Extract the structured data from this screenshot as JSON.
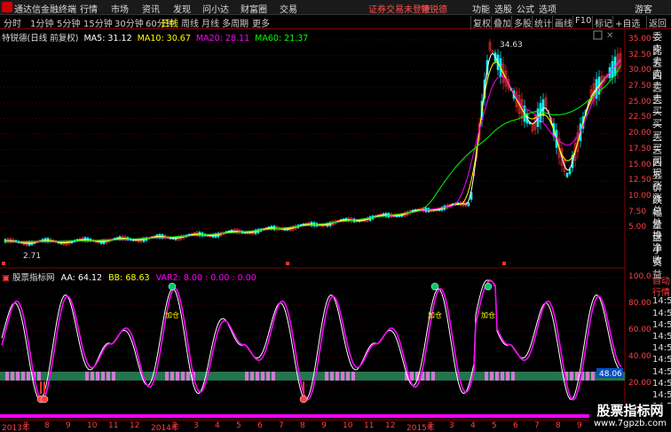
{
  "app": {
    "title": "通达信金融终端",
    "login": "证券交易未登录",
    "stock": "特锐德",
    "guest": "游客"
  },
  "menu": [
    "行情",
    "市场",
    "资讯",
    "发现",
    "问小达",
    "财富圈",
    "交易"
  ],
  "right_menu": [
    "功能",
    "选股",
    "公式",
    "选项"
  ],
  "periods": [
    "分时",
    "1分钟",
    "5分钟",
    "15分钟",
    "30分钟",
    "60分钟",
    "日线",
    "周线",
    "月线",
    "多周期",
    "更多"
  ],
  "active_period": "日线",
  "tools": [
    "复权",
    "叠加",
    "多股",
    "统计",
    "画线",
    "F10",
    "标记",
    "+自选",
    "返回"
  ],
  "main_info": {
    "name": "特锐德(日线 前复权)",
    "ma5": "MA5: 31.12",
    "ma10": "MA10: 30.67",
    "ma20": "MA20: 28.11",
    "ma60": "MA60: 21.37"
  },
  "price_axis": [
    "35.00",
    "32.50",
    "30.00",
    "27.50",
    "25.00",
    "22.50",
    "20.00",
    "17.50",
    "15.00",
    "12.50",
    "10.00",
    "7.50",
    "5.00"
  ],
  "peak_label": "34.63",
  "low_label": "2.71",
  "side_labels": [
    "委比",
    "卖五",
    "卖四",
    "卖三",
    "卖二",
    "卖一",
    "买一",
    "买二",
    "买三",
    "买四",
    "买五",
    "现价",
    "涨跌",
    "涨幅",
    "总量",
    "外盘",
    "换手",
    "净资",
    "收益"
  ],
  "indicator_info": {
    "name": "股票指标网",
    "aa": "AA: 64.12",
    "bb": "BB: 68.63",
    "var2": "VAR2: 8.00 : 0.00 : 0.00"
  },
  "ind_axis": [
    "100.0",
    "80.00",
    "60.00",
    "40.00",
    "20.00"
  ],
  "ind_marker": "48.06",
  "ind_side": [
    "自动",
    "行情",
    "14:50",
    "14:50",
    "14:50",
    "14:50",
    "14:50",
    "14:50",
    "14:50",
    "14:50",
    "14:50",
    "14:50",
    "14:50"
  ],
  "jia_cang": "加仓",
  "x_axis": [
    "2013年",
    "7",
    "8",
    "9",
    "10",
    "11",
    "12",
    "2014年",
    "2",
    "3",
    "4",
    "5",
    "6",
    "7",
    "8",
    "9",
    "10",
    "11",
    "12",
    "2015年",
    "2",
    "3",
    "4",
    "5",
    "6",
    "7",
    "8",
    "9",
    "10",
    "11"
  ],
  "watermark": {
    "line1": "股票指标网",
    "line2": "www.7gpzb.com"
  },
  "colors": {
    "ma5": "#ffffff",
    "ma10": "#ffff00",
    "ma20": "#ff00ff",
    "ma60": "#00ff00",
    "up": "#ff3030",
    "down": "#00ffff",
    "axis": "#ff4040"
  },
  "chart_data": {
    "type": "line",
    "series": [
      {
        "name": "MA5",
        "values": [
          2.8,
          3.5,
          4.2,
          4.8,
          4.6,
          5.1,
          5.8,
          6.9,
          7.4,
          7.6,
          7.8,
          8.0,
          8.3,
          9.0,
          9.6,
          30.0,
          27.0,
          21.0,
          22.5,
          18.5,
          16.0,
          14.0,
          18.5,
          24.0,
          28.0,
          31.12
        ]
      },
      {
        "name": "MA60",
        "values": [
          2.7,
          3.0,
          3.6,
          4.3,
          4.6,
          4.9,
          5.4,
          6.4,
          7.1,
          7.5,
          7.7,
          7.9,
          8.1,
          8.5,
          9.0,
          13.0,
          17.0,
          19.5,
          21.5,
          22.5,
          21.0,
          18.0,
          17.0,
          18.0,
          19.5,
          21.37
        ]
      }
    ],
    "ylim": [
      2.5,
      35
    ]
  }
}
